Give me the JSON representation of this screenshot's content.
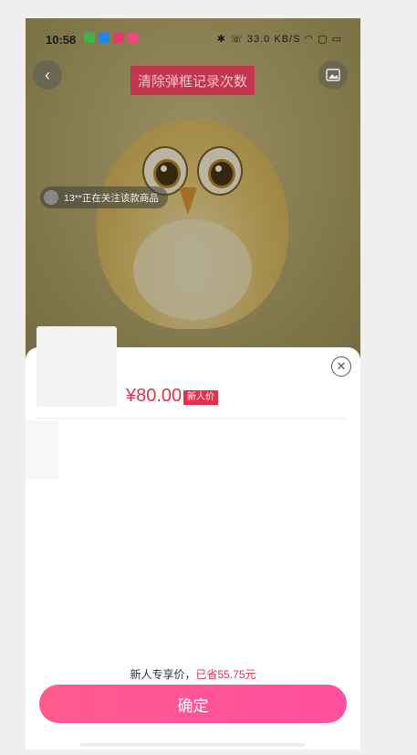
{
  "status_bar": {
    "time": "10:58",
    "right_text": "33.0 KB/S"
  },
  "hero": {
    "clear_button_label": "清除弹框记录次数",
    "watch_text": "13**正在关注该款商品"
  },
  "sheet": {
    "price": "¥80.00",
    "price_tag": "新人价",
    "hint_prefix": "新人专享价，",
    "hint_saved": "已省55.75元",
    "confirm_label": "确定"
  },
  "colors": {
    "accent": "#e5304c",
    "button_gradient_start": "#ff5a8e",
    "button_gradient_end": "#ff4f9f"
  }
}
